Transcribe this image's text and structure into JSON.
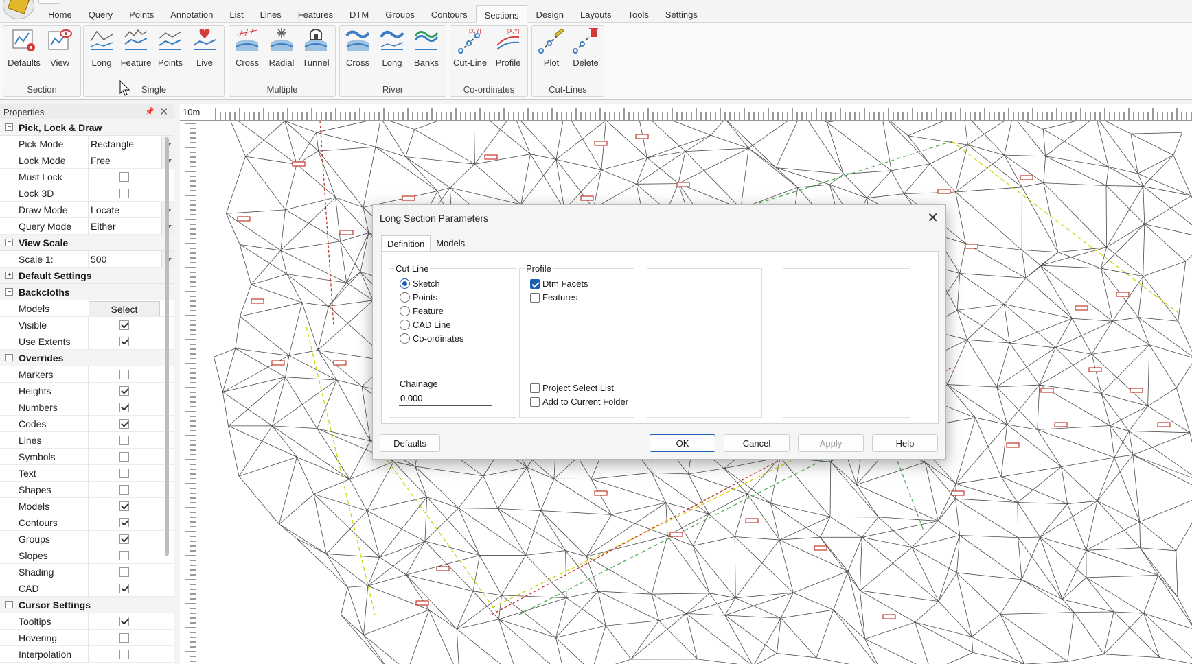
{
  "menu": {
    "tabs": [
      "Home",
      "Query",
      "Points",
      "Annotation",
      "List",
      "Lines",
      "Features",
      "DTM",
      "Groups",
      "Contours",
      "Sections",
      "Design",
      "Layouts",
      "Tools",
      "Settings"
    ],
    "active": "Sections"
  },
  "ribbon": {
    "groups": [
      {
        "label": "Section",
        "buttons": [
          "Defaults",
          "View"
        ]
      },
      {
        "label": "Single",
        "buttons": [
          "Long",
          "Feature",
          "Points",
          "Live"
        ]
      },
      {
        "label": "Multiple",
        "buttons": [
          "Cross",
          "Radial",
          "Tunnel"
        ]
      },
      {
        "label": "River",
        "buttons": [
          "Cross",
          "Long",
          "Banks"
        ]
      },
      {
        "label": "Co-ordinates",
        "buttons": [
          "Cut-Line",
          "Profile"
        ]
      },
      {
        "label": "Cut-Lines",
        "buttons": [
          "Plot",
          "Delete"
        ]
      }
    ]
  },
  "properties": {
    "title": "Properties",
    "pick_lock_draw": {
      "label": "Pick, Lock & Draw",
      "pick_mode": {
        "name": "Pick Mode",
        "value": "Rectangle"
      },
      "lock_mode": {
        "name": "Lock Mode",
        "value": "Free"
      },
      "must_lock": {
        "name": "Must Lock",
        "checked": false
      },
      "lock_3d": {
        "name": "Lock 3D",
        "checked": false
      },
      "draw_mode": {
        "name": "Draw Mode",
        "value": "Locate"
      },
      "query_mode": {
        "name": "Query Mode",
        "value": "Either"
      }
    },
    "view_scale": {
      "label": "View Scale",
      "scale": {
        "name": "Scale 1:",
        "value": "500"
      }
    },
    "default_settings": {
      "label": "Default Settings"
    },
    "backcloths": {
      "label": "Backcloths",
      "models": {
        "name": "Models",
        "button": "Select"
      },
      "visible": {
        "name": "Visible",
        "checked": true
      },
      "use_extents": {
        "name": "Use Extents",
        "checked": true
      }
    },
    "overrides": {
      "label": "Overrides",
      "items": [
        {
          "name": "Markers",
          "checked": false
        },
        {
          "name": "Heights",
          "checked": true
        },
        {
          "name": "Numbers",
          "checked": true
        },
        {
          "name": "Codes",
          "checked": true
        },
        {
          "name": "Lines",
          "checked": false
        },
        {
          "name": "Symbols",
          "checked": false
        },
        {
          "name": "Text",
          "checked": false
        },
        {
          "name": "Shapes",
          "checked": false
        },
        {
          "name": "Models",
          "checked": true
        },
        {
          "name": "Contours",
          "checked": true
        },
        {
          "name": "Groups",
          "checked": true
        },
        {
          "name": "Slopes",
          "checked": false
        },
        {
          "name": "Shading",
          "checked": false
        },
        {
          "name": "CAD",
          "checked": true
        }
      ]
    },
    "cursor_settings": {
      "label": "Cursor Settings",
      "items": [
        {
          "name": "Tooltips",
          "checked": true
        },
        {
          "name": "Hovering",
          "checked": false
        },
        {
          "name": "Interpolation",
          "checked": false
        }
      ]
    }
  },
  "canvas": {
    "scale_label": "10m"
  },
  "dialog": {
    "title": "Long Section Parameters",
    "tabs": [
      "Definition",
      "Models"
    ],
    "active_tab": "Definition",
    "cut_line": {
      "title": "Cut Line",
      "options": [
        "Sketch",
        "Points",
        "Feature",
        "CAD Line",
        "Co-ordinates"
      ],
      "selected": "Sketch",
      "chainage_label": "Chainage",
      "chainage_value": "0.000"
    },
    "profile": {
      "title": "Profile",
      "dtm_facets": {
        "label": "Dtm Facets",
        "checked": true
      },
      "features": {
        "label": "Features",
        "checked": false
      },
      "project_select_list": {
        "label": "Project Select List",
        "checked": false
      },
      "add_to_current_folder": {
        "label": "Add to Current Folder",
        "checked": false
      }
    },
    "buttons": {
      "defaults": "Defaults",
      "ok": "OK",
      "cancel": "Cancel",
      "apply": "Apply",
      "help": "Help"
    }
  },
  "colors": {
    "accent": "#1a5fb4",
    "tin_lines": "#4a4a4a",
    "labels": "#c0392b",
    "breakline_yellow": "#d4d400",
    "breakline_green": "#4caf50"
  }
}
